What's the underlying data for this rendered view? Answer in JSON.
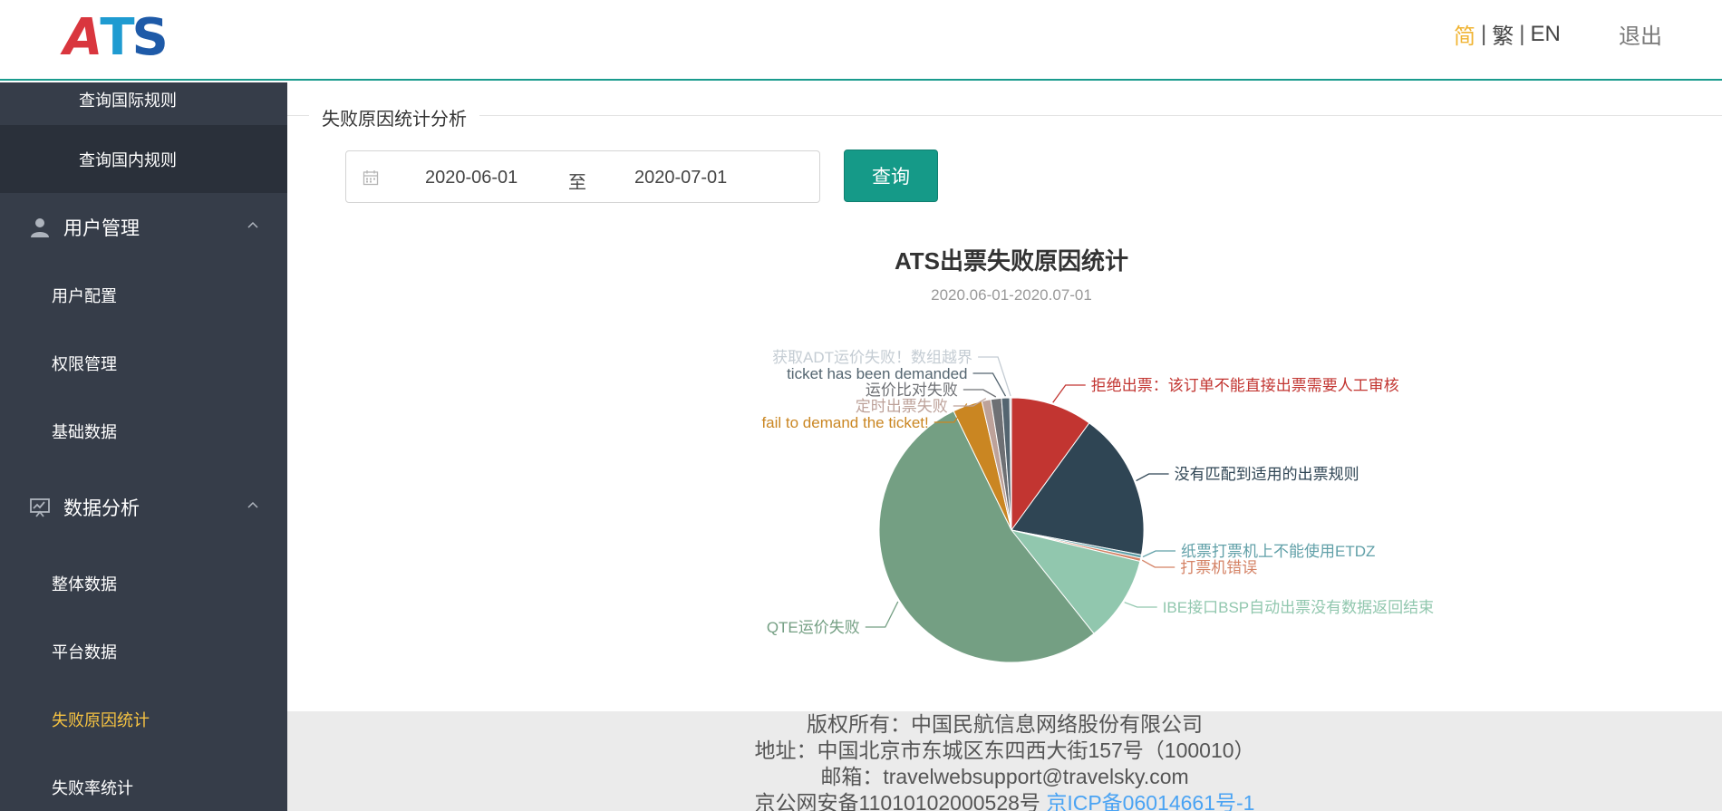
{
  "header": {
    "logo_text": "ATS",
    "lang_simplified": "简",
    "lang_traditional": "繁",
    "lang_english": "EN",
    "lang_sep": "|",
    "logout_label": "退出"
  },
  "sidebar": {
    "items": [
      {
        "label": "查询国际规则"
      },
      {
        "label": "查询国内规则"
      },
      {
        "label": "用户管理"
      },
      {
        "label": "用户配置"
      },
      {
        "label": "权限管理"
      },
      {
        "label": "基础数据"
      },
      {
        "label": "数据分析"
      },
      {
        "label": "整体数据"
      },
      {
        "label": "平台数据"
      },
      {
        "label": "失败原因统计"
      },
      {
        "label": "失败率统计"
      }
    ]
  },
  "main": {
    "section_title": "失败原因统计分析",
    "date_start": "2020-06-01",
    "date_to": "至",
    "date_end": "2020-07-01",
    "query_label": "查询"
  },
  "chart_data": {
    "type": "pie",
    "title": "ATS出票失败原因统计",
    "subtitle": "2020.06-01-2020.07-01",
    "slices": [
      {
        "name": "拒绝出票：该订单不能直接出票需要人工审核",
        "value": 10.0,
        "color": "#c23531"
      },
      {
        "name": "没有匹配到适用的出票规则",
        "value": 18.0,
        "color": "#2f4554"
      },
      {
        "name": "纸票打票机上不能使用ETDZ",
        "value": 0.4,
        "color": "#61a0a8"
      },
      {
        "name": "打票机错误",
        "value": 0.4,
        "color": "#d48265"
      },
      {
        "name": "IBE接口BSP自动出票没有数据返回结束",
        "value": 10.5,
        "color": "#91c7ae"
      },
      {
        "name": "QTE运价失败",
        "value": 53.5,
        "color": "#749f83"
      },
      {
        "name": "fail to demand the ticket!",
        "value": 3.6,
        "color": "#ca8622"
      },
      {
        "name": "定时出票失败",
        "value": 1.1,
        "color": "#bda29a"
      },
      {
        "name": "运价比对失败",
        "value": 1.3,
        "color": "#6e7074"
      },
      {
        "name": "ticket has been demanded",
        "value": 1.0,
        "color": "#546570"
      },
      {
        "name": "获取ADT运价失败！数组越界",
        "value": 0.2,
        "color": "#c4ccd3"
      }
    ]
  },
  "footer": {
    "copyright": "版权所有：中国民航信息网络股份有限公司",
    "address": "地址：中国北京市东城区东四西大街157号（100010）",
    "email": "邮箱：travelwebsupport@travelsky.com",
    "beian": "京公网安备11010102000528号",
    "icp": "京ICP备06014661号-1"
  }
}
